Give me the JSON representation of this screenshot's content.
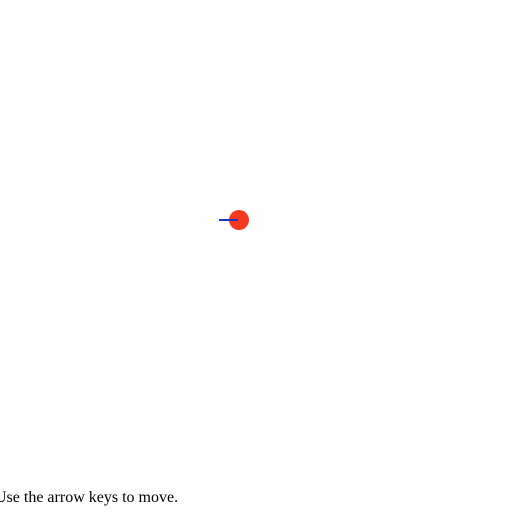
{
  "game": {
    "instructions": "Use the arrow keys to move.",
    "player": {
      "ball_color": "#f33a1f",
      "direction_indicator_color": "#2233cc"
    }
  }
}
